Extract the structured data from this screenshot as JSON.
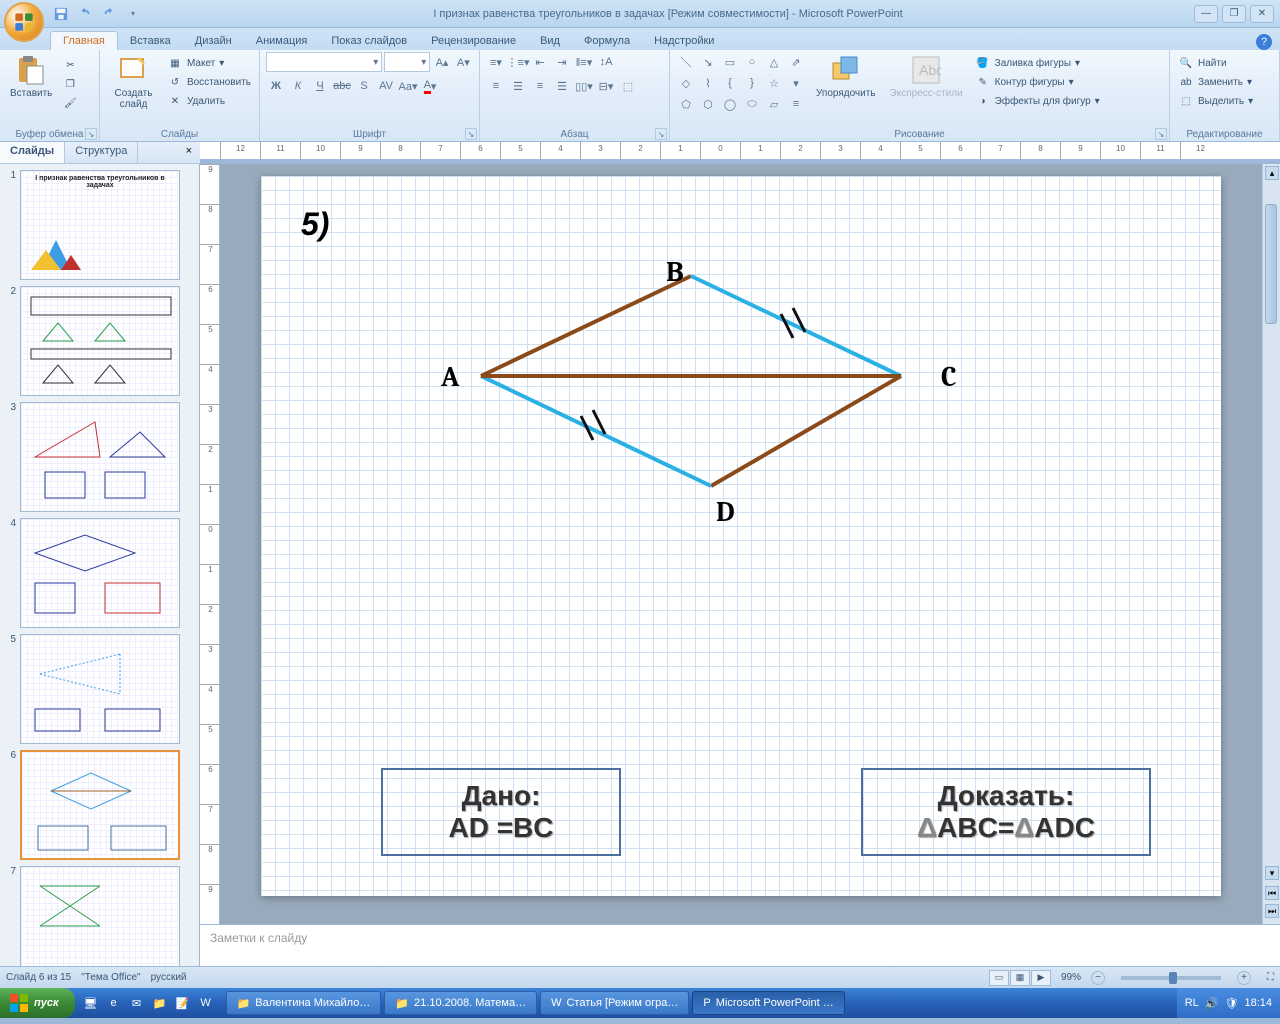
{
  "titlebar": {
    "title": "I признак равенства треугольников в задачах [Режим совместимости] - Microsoft PowerPoint"
  },
  "ribbon_tabs": [
    "Главная",
    "Вставка",
    "Дизайн",
    "Анимация",
    "Показ слайдов",
    "Рецензирование",
    "Вид",
    "Формула",
    "Надстройки"
  ],
  "ribbon_active": 0,
  "groups": {
    "clipboard": {
      "label": "Буфер обмена",
      "paste": "Вставить"
    },
    "slides": {
      "label": "Слайды",
      "new_slide": "Создать слайд",
      "layout": "Макет",
      "reset": "Восстановить",
      "delete": "Удалить"
    },
    "font": {
      "label": "Шрифт"
    },
    "paragraph": {
      "label": "Абзац"
    },
    "drawing": {
      "label": "Рисование",
      "arrange": "Упорядочить",
      "styles": "Экспресс-стили",
      "fill": "Заливка фигуры",
      "outline": "Контур фигуры",
      "effects": "Эффекты для фигур"
    },
    "editing": {
      "label": "Редактирование",
      "find": "Найти",
      "replace": "Заменить",
      "select": "Выделить"
    }
  },
  "panel_tabs": {
    "slides": "Слайды",
    "outline": "Структура"
  },
  "thumbnails": [
    {
      "n": 1,
      "title": "I признак равенства треугольников в задачах"
    },
    {
      "n": 2,
      "title": ""
    },
    {
      "n": 3,
      "title": ""
    },
    {
      "n": 4,
      "title": ""
    },
    {
      "n": 5,
      "title": ""
    },
    {
      "n": 6,
      "title": ""
    },
    {
      "n": 7,
      "title": ""
    }
  ],
  "selected_thumb": 6,
  "slide": {
    "problem_number": "5)",
    "vertices": {
      "A": "A",
      "B": "B",
      "C": "C",
      "D": "D"
    },
    "given_label": "Дано:",
    "given_body": "AD =BC",
    "prove_label": "Доказать:",
    "prove_body_prefix": "Δ",
    "prove_body": "ABC=",
    "prove_body_prefix2": "Δ",
    "prove_body2": "ADC"
  },
  "notes_placeholder": "Заметки к слайду",
  "ruler_marks": [
    "12",
    "11",
    "10",
    "9",
    "8",
    "7",
    "6",
    "5",
    "4",
    "3",
    "2",
    "1",
    "0",
    "1",
    "2",
    "3",
    "4",
    "5",
    "6",
    "7",
    "8",
    "9",
    "10",
    "11",
    "12"
  ],
  "ruler_v": [
    "9",
    "8",
    "7",
    "6",
    "5",
    "4",
    "3",
    "2",
    "1",
    "0",
    "1",
    "2",
    "3",
    "4",
    "5",
    "6",
    "7",
    "8",
    "9"
  ],
  "status": {
    "slide_info": "Слайд 6 из 15",
    "theme": "\"Тема Office\"",
    "lang": "русский",
    "zoom": "99%",
    "lang_ind": "RL"
  },
  "taskbar": {
    "start": "пуск",
    "tasks": [
      "Валентина Михайло…",
      "21.10.2008. Матема…",
      "Статья [Режим огра…",
      "Microsoft PowerPoint …"
    ],
    "active_task": 3,
    "tray_lang": "RL",
    "clock": "18:14"
  }
}
